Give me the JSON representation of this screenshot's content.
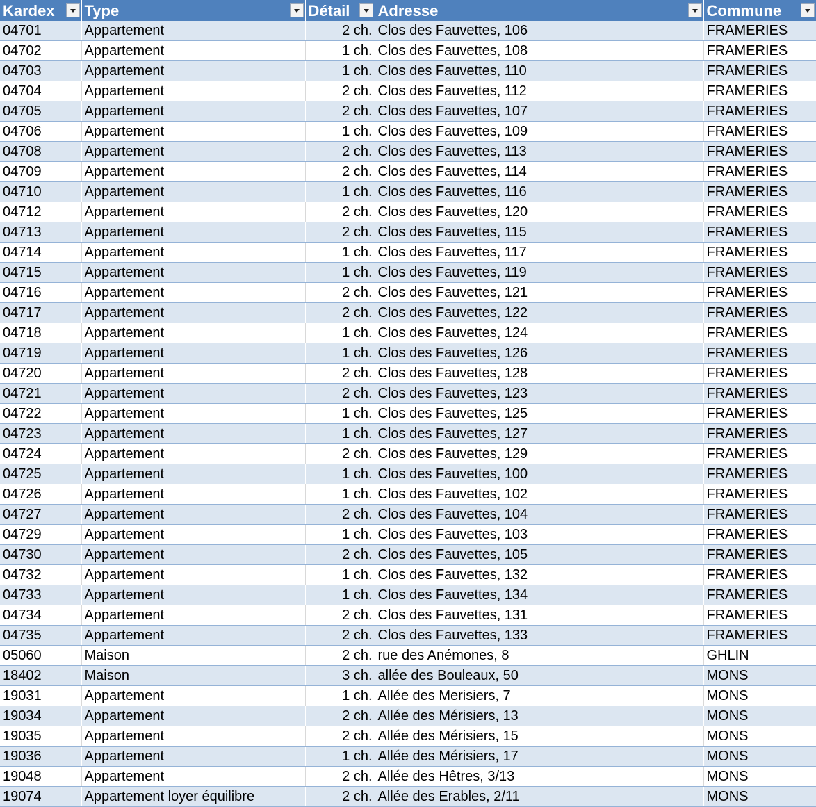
{
  "headers": {
    "kardex": "Kardex",
    "type": "Type",
    "detail": "Détail",
    "adresse": "Adresse",
    "commune": "Commune"
  },
  "colors": {
    "header_bg": "#4f81bd",
    "band": "#dce6f1",
    "row_border": "#95b3d7"
  },
  "icons": {
    "filter": "dropdown-filter-icon"
  },
  "rows": [
    {
      "kardex": "04701",
      "type": "Appartement",
      "detail": "2 ch.",
      "adresse": "Clos des Fauvettes, 106",
      "commune": "FRAMERIES"
    },
    {
      "kardex": "04702",
      "type": "Appartement",
      "detail": "1 ch.",
      "adresse": "Clos des Fauvettes, 108",
      "commune": "FRAMERIES"
    },
    {
      "kardex": "04703",
      "type": "Appartement",
      "detail": "1 ch.",
      "adresse": "Clos des Fauvettes, 110",
      "commune": "FRAMERIES"
    },
    {
      "kardex": "04704",
      "type": "Appartement",
      "detail": "2 ch.",
      "adresse": "Clos des Fauvettes, 112",
      "commune": "FRAMERIES"
    },
    {
      "kardex": "04705",
      "type": "Appartement",
      "detail": "2 ch.",
      "adresse": "Clos des Fauvettes, 107",
      "commune": "FRAMERIES"
    },
    {
      "kardex": "04706",
      "type": "Appartement",
      "detail": "1 ch.",
      "adresse": "Clos des Fauvettes, 109",
      "commune": "FRAMERIES"
    },
    {
      "kardex": "04708",
      "type": "Appartement",
      "detail": "2 ch.",
      "adresse": "Clos des Fauvettes, 113",
      "commune": "FRAMERIES"
    },
    {
      "kardex": "04709",
      "type": "Appartement",
      "detail": "2 ch.",
      "adresse": "Clos des Fauvettes, 114",
      "commune": "FRAMERIES"
    },
    {
      "kardex": "04710",
      "type": "Appartement",
      "detail": "1 ch.",
      "adresse": "Clos des Fauvettes, 116",
      "commune": "FRAMERIES"
    },
    {
      "kardex": "04712",
      "type": "Appartement",
      "detail": "2 ch.",
      "adresse": "Clos des Fauvettes, 120",
      "commune": "FRAMERIES"
    },
    {
      "kardex": "04713",
      "type": "Appartement",
      "detail": "2 ch.",
      "adresse": "Clos des Fauvettes, 115",
      "commune": "FRAMERIES"
    },
    {
      "kardex": "04714",
      "type": "Appartement",
      "detail": "1 ch.",
      "adresse": "Clos des Fauvettes, 117",
      "commune": "FRAMERIES"
    },
    {
      "kardex": "04715",
      "type": "Appartement",
      "detail": "1 ch.",
      "adresse": "Clos des Fauvettes, 119",
      "commune": "FRAMERIES"
    },
    {
      "kardex": "04716",
      "type": "Appartement",
      "detail": "2 ch.",
      "adresse": "Clos des Fauvettes, 121",
      "commune": "FRAMERIES"
    },
    {
      "kardex": "04717",
      "type": "Appartement",
      "detail": "2 ch.",
      "adresse": "Clos des Fauvettes, 122",
      "commune": "FRAMERIES"
    },
    {
      "kardex": "04718",
      "type": "Appartement",
      "detail": "1 ch.",
      "adresse": "Clos des Fauvettes, 124",
      "commune": "FRAMERIES"
    },
    {
      "kardex": "04719",
      "type": "Appartement",
      "detail": "1 ch.",
      "adresse": "Clos des Fauvettes, 126",
      "commune": "FRAMERIES"
    },
    {
      "kardex": "04720",
      "type": "Appartement",
      "detail": "2 ch.",
      "adresse": "Clos des Fauvettes, 128",
      "commune": "FRAMERIES"
    },
    {
      "kardex": "04721",
      "type": "Appartement",
      "detail": "2 ch.",
      "adresse": "Clos des Fauvettes, 123",
      "commune": "FRAMERIES"
    },
    {
      "kardex": "04722",
      "type": "Appartement",
      "detail": "1 ch.",
      "adresse": "Clos des Fauvettes, 125",
      "commune": "FRAMERIES"
    },
    {
      "kardex": "04723",
      "type": "Appartement",
      "detail": "1 ch.",
      "adresse": "Clos des Fauvettes, 127",
      "commune": "FRAMERIES"
    },
    {
      "kardex": "04724",
      "type": "Appartement",
      "detail": "2 ch.",
      "adresse": "Clos des Fauvettes, 129",
      "commune": "FRAMERIES"
    },
    {
      "kardex": "04725",
      "type": "Appartement",
      "detail": "1 ch.",
      "adresse": "Clos des Fauvettes, 100",
      "commune": "FRAMERIES"
    },
    {
      "kardex": "04726",
      "type": "Appartement",
      "detail": "1 ch.",
      "adresse": "Clos des Fauvettes, 102",
      "commune": "FRAMERIES"
    },
    {
      "kardex": "04727",
      "type": "Appartement",
      "detail": "2 ch.",
      "adresse": "Clos des Fauvettes, 104",
      "commune": "FRAMERIES"
    },
    {
      "kardex": "04729",
      "type": "Appartement",
      "detail": "1 ch.",
      "adresse": "Clos des Fauvettes, 103",
      "commune": "FRAMERIES"
    },
    {
      "kardex": "04730",
      "type": "Appartement",
      "detail": "2 ch.",
      "adresse": "Clos des Fauvettes, 105",
      "commune": "FRAMERIES"
    },
    {
      "kardex": "04732",
      "type": "Appartement",
      "detail": "1 ch.",
      "adresse": "Clos des Fauvettes, 132",
      "commune": "FRAMERIES"
    },
    {
      "kardex": "04733",
      "type": "Appartement",
      "detail": "1 ch.",
      "adresse": "Clos des Fauvettes, 134",
      "commune": "FRAMERIES"
    },
    {
      "kardex": "04734",
      "type": "Appartement",
      "detail": "2 ch.",
      "adresse": "Clos des Fauvettes, 131",
      "commune": "FRAMERIES"
    },
    {
      "kardex": "04735",
      "type": "Appartement",
      "detail": "2 ch.",
      "adresse": "Clos des Fauvettes, 133",
      "commune": "FRAMERIES"
    },
    {
      "kardex": "05060",
      "type": "Maison",
      "detail": "2 ch.",
      "adresse": "rue des Anémones, 8",
      "commune": "GHLIN"
    },
    {
      "kardex": "18402",
      "type": "Maison",
      "detail": "3 ch.",
      "adresse": "allée des Bouleaux, 50",
      "commune": "MONS"
    },
    {
      "kardex": "19031",
      "type": "Appartement",
      "detail": "1 ch.",
      "adresse": "Allée des Merisiers, 7",
      "commune": "MONS"
    },
    {
      "kardex": "19034",
      "type": "Appartement",
      "detail": "2 ch.",
      "adresse": "Allée des Mérisiers, 13",
      "commune": "MONS"
    },
    {
      "kardex": "19035",
      "type": "Appartement",
      "detail": "2 ch.",
      "adresse": "Allée des Mérisiers, 15",
      "commune": "MONS"
    },
    {
      "kardex": "19036",
      "type": "Appartement",
      "detail": "1 ch.",
      "adresse": "Allée des Mérisiers, 17",
      "commune": "MONS"
    },
    {
      "kardex": "19048",
      "type": "Appartement",
      "detail": "2 ch.",
      "adresse": "Allée des Hêtres, 3/13",
      "commune": "MONS"
    },
    {
      "kardex": "19074",
      "type": "Appartement loyer équilibre",
      "detail": "2 ch.",
      "adresse": "Allée des Erables, 2/11",
      "commune": "MONS"
    }
  ]
}
